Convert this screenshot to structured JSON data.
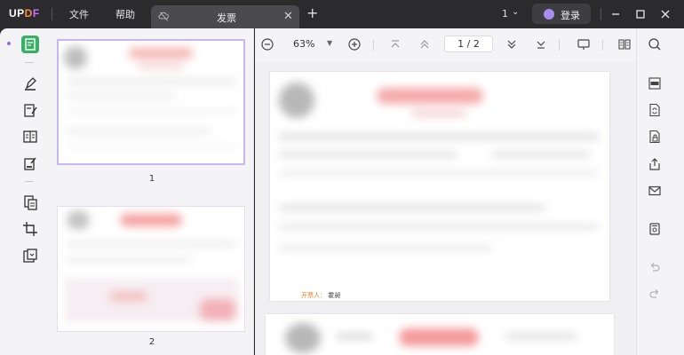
{
  "app": {
    "logo": "UPDF",
    "menu": [
      "文件",
      "帮助"
    ],
    "tab_title": "发票",
    "window_count": "1",
    "login_label": "登录"
  },
  "toolbar": {
    "zoom": "63%",
    "page_indicator": "1 / 2"
  },
  "thumbnails": [
    {
      "page": "1",
      "selected": true
    },
    {
      "page": "2",
      "selected": false
    }
  ],
  "document": {
    "footer_label": "开票人：",
    "footer_value": "霍昶"
  },
  "colors": {
    "accent": "#8d6cf0",
    "active_tool": "#3cae68",
    "titlebar": "#2b2b2e",
    "stamp": "#f5a5a5"
  },
  "icons": {
    "left_rail": [
      "reader-icon",
      "highlighter-icon",
      "edit-text-icon",
      "organize-pages-icon",
      "fill-sign-icon",
      "convert-icon",
      "crop-icon",
      "compress-icon"
    ],
    "right_rail": [
      "search-icon",
      "ocr-icon",
      "convert-pdf-icon",
      "protect-icon",
      "share-icon",
      "email-icon",
      "save-icon",
      "undo-icon",
      "redo-icon"
    ]
  }
}
